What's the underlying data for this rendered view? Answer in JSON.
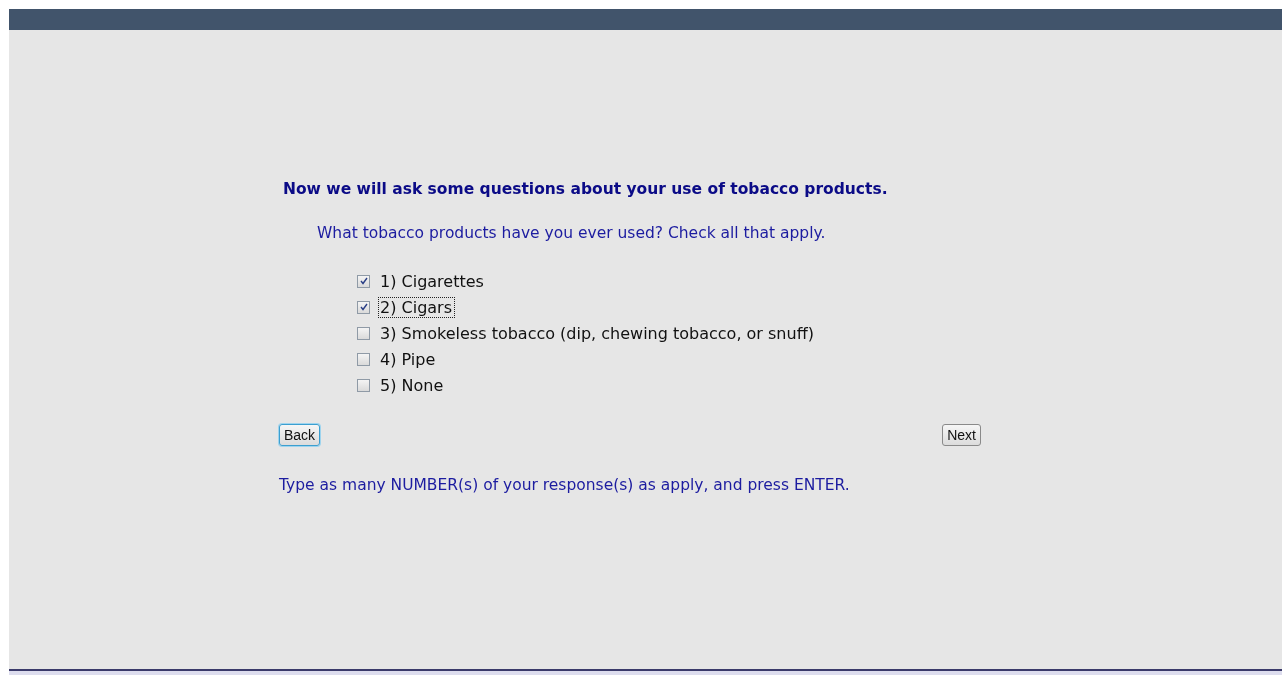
{
  "heading": "Now we will ask some questions about your use of tobacco products.",
  "question": "What tobacco products have you ever used? Check all that apply.",
  "options": [
    {
      "label": "1) Cigarettes",
      "checked": true,
      "focused": false
    },
    {
      "label": "2) Cigars",
      "checked": true,
      "focused": true
    },
    {
      "label": "3) Smokeless tobacco (dip, chewing tobacco, or snuff)",
      "checked": false,
      "focused": false
    },
    {
      "label": "4) Pipe",
      "checked": false,
      "focused": false
    },
    {
      "label": "5) None",
      "checked": false,
      "focused": false
    }
  ],
  "buttons": [
    {
      "label": "Back",
      "focused": true
    },
    {
      "label": "Next",
      "focused": false
    }
  ],
  "instructions": "Type as many NUMBER(s) of your response(s) as apply, and press ENTER."
}
